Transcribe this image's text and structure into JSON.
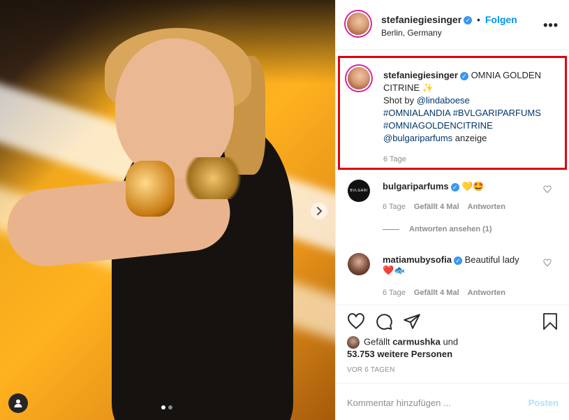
{
  "post": {
    "image_alt": "",
    "carousel": {
      "dot_count": 2,
      "active_index": 0
    }
  },
  "header": {
    "username": "stefaniegiesinger",
    "separator": "•",
    "follow_label": "Folgen",
    "location": "Berlin, Germany",
    "more_label": "•••"
  },
  "caption": {
    "username": "stefaniegiesinger",
    "title": "OMNIA GOLDEN CITRINE",
    "sparkle": "✨",
    "shot_by_prefix": "Shot by ",
    "shot_by_handle": "@lindaboese",
    "hashtags_line1": "#OMNIALANDIA #BVLGARIPARFUMS",
    "hashtags_line2": "#OMNIAGOLDENCITRINE",
    "mention": "@bulgariparfums",
    "suffix": " anzeige",
    "time": "6 Tage"
  },
  "comments": [
    {
      "username": "bulgariparfums",
      "text": "💛🤩",
      "avatar_text": "BVLGARI",
      "time": "6 Tage",
      "likes": "Gefällt 4 Mal",
      "reply_label": "Antworten"
    },
    {
      "username": "matiamubysofia",
      "text": "Beautiful lady",
      "emoji": "❤️🐟",
      "time": "6 Tage",
      "likes": "Gefällt 4 Mal",
      "reply_label": "Antworten"
    }
  ],
  "replies": {
    "label": "Antworten ansehen (1)"
  },
  "likes": {
    "prefix": "Gefällt ",
    "user": "carmushka",
    "connector": " und",
    "others": "53.753 weitere Personen"
  },
  "posted": "VOR 6 TAGEN",
  "comment_input": {
    "placeholder": "Kommentar hinzufügen ...",
    "post_label": "Posten"
  }
}
